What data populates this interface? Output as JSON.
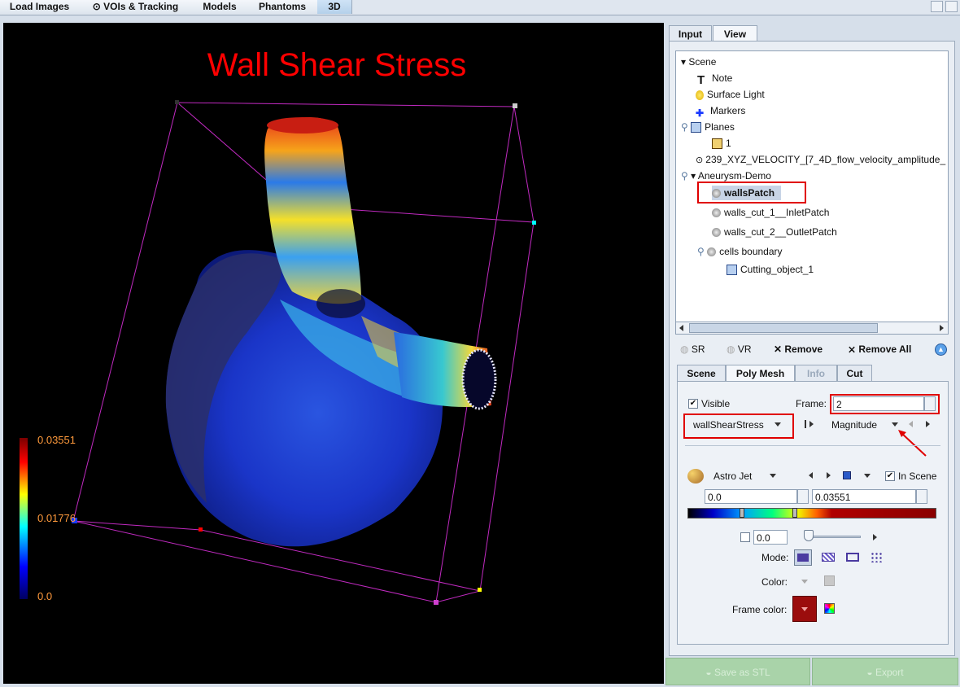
{
  "top_tabs": [
    {
      "label": "Load Images"
    },
    {
      "label": "VOIs & Tracking"
    },
    {
      "label": "Models"
    },
    {
      "label": "Phantoms"
    },
    {
      "label": "3D"
    }
  ],
  "viewport": {
    "title": "Wall Shear Stress",
    "legend": {
      "max": "0.03551",
      "mid": "0.01776",
      "min": "0.0"
    }
  },
  "panel_tabs": [
    {
      "label": "Input"
    },
    {
      "label": "View"
    }
  ],
  "scene_tree": {
    "items": [
      {
        "label": "Scene"
      },
      {
        "label": "Note"
      },
      {
        "label": "Surface Light"
      },
      {
        "label": "Markers"
      },
      {
        "label": "Planes"
      },
      {
        "label": "1"
      },
      {
        "label": "239_XYZ_VELOCITY_[7_4D_flow_velocity_amplitude_"
      },
      {
        "label": "Aneurysm-Demo"
      },
      {
        "label": "wallsPatch"
      },
      {
        "label": "walls_cut_1__InletPatch"
      },
      {
        "label": "walls_cut_2__OutletPatch"
      },
      {
        "label": "cells boundary"
      },
      {
        "label": "Cutting_object_1"
      }
    ]
  },
  "toolbar": {
    "sr": "SR",
    "vr": "VR",
    "remove": "Remove",
    "remove_all": "Remove All"
  },
  "prop_tabs": [
    {
      "label": "Scene"
    },
    {
      "label": "Poly Mesh"
    },
    {
      "label": "Info"
    },
    {
      "label": "Cut"
    }
  ],
  "poly_mesh": {
    "visible_label": "Visible",
    "frame_label": "Frame:",
    "frame_value": "2",
    "scalar": "wallShearStress",
    "component": "Magnitude",
    "colormap": "Astro Jet",
    "in_scene_label": "In Scene",
    "range_min": "0.0",
    "range_max": "0.03551",
    "opacity_value": "0.0",
    "mode_label": "Mode:",
    "color_label": "Color:",
    "frame_color_label": "Frame color:",
    "frame_color": "#9b0d0d"
  },
  "bottom_buttons": [
    {
      "label": "Save as STL"
    },
    {
      "label": "Export"
    }
  ]
}
